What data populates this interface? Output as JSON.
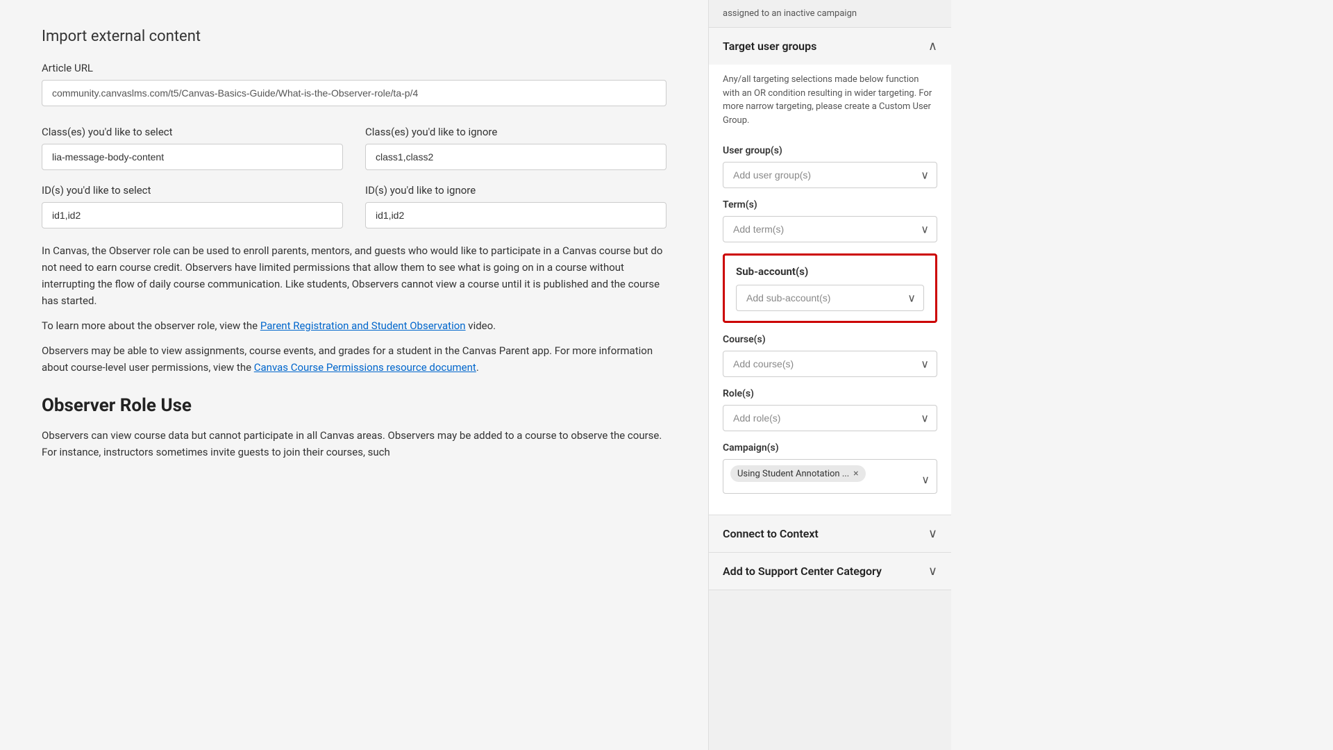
{
  "main": {
    "import_section_title": "Import external content",
    "article_url_label": "Article URL",
    "article_url_value": "community.canvaslms.com/t5/Canvas-Basics-Guide/What-is-the-Observer-role/ta-p/4",
    "classes_select_label": "Class(es) you'd like to select",
    "classes_select_value": "lia-message-body-content",
    "classes_ignore_label": "Class(es) you'd like to ignore",
    "classes_ignore_value": "class1,class2",
    "ids_select_label": "ID(s) you'd like to select",
    "ids_select_value": "id1,id2",
    "ids_ignore_label": "ID(s) you'd like to ignore",
    "ids_ignore_value": "id1,id2",
    "body_text_1": "In Canvas, the Observer role can be used to enroll parents, mentors, and guests who would like to participate in a Canvas course but do not need to earn course credit. Observers have limited permissions that allow them to see what is going on in a course without interrupting the flow of daily course communication. Like students, Observers cannot view a course until it is published and the course has started.",
    "body_text_2": "To learn more about the observer role, view the ",
    "body_link_1": "Parent Registration and Student Observation",
    "body_text_3": " video.",
    "body_text_4": "Observers may be able to view assignments, course events, and grades for a student in the Canvas Parent app. For more information about course-level user permissions, view the ",
    "body_link_2": "Canvas Course Permissions resource document",
    "body_text_5": ".",
    "observer_role_heading": "Observer Role Use",
    "observer_role_body": "Observers can view course data but cannot participate in all Canvas areas. Observers may be added to a course to observe the course. For instance, instructors sometimes invite guests to join their courses, such"
  },
  "sidebar": {
    "top_note": "assigned to an inactive campaign",
    "target_group_label": "Target user groups",
    "target_group_desc": "Any/all targeting selections made below function with an OR condition resulting in wider targeting. For more narrow targeting, please create a Custom User Group.",
    "user_groups_label": "User group(s)",
    "user_groups_placeholder": "Add user group(s)",
    "terms_label": "Term(s)",
    "terms_placeholder": "Add term(s)",
    "sub_accounts_label": "Sub-account(s)",
    "sub_accounts_placeholder": "Add sub-account(s)",
    "courses_label": "Course(s)",
    "courses_placeholder": "Add course(s)",
    "roles_label": "Role(s)",
    "roles_placeholder": "Add role(s)",
    "campaigns_label": "Campaign(s)",
    "campaign_tag": "Using Student Annotation ...",
    "connect_context_label": "Connect to Context",
    "add_support_label": "Add to Support Center Category",
    "chevron_up": "∧",
    "chevron_down": "∨"
  }
}
